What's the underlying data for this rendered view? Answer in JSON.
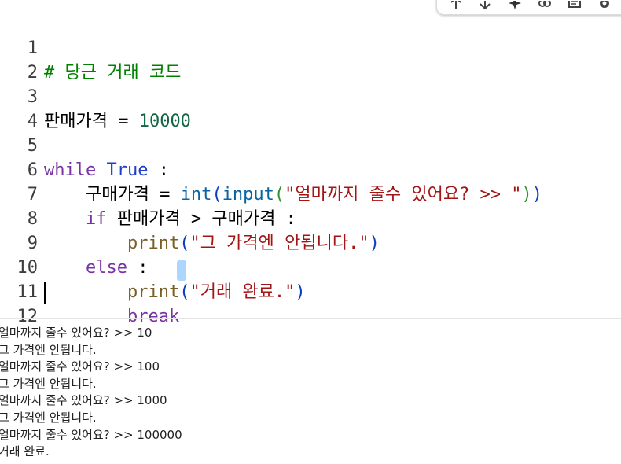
{
  "toolbar": {
    "buttons": [
      "move-up-icon",
      "move-down-icon",
      "sparkle-icon",
      "link-icon",
      "comment-icon",
      "settings-icon"
    ]
  },
  "editor": {
    "lines": [
      {
        "number": "1",
        "text": "# 당근 거래 코드"
      },
      {
        "number": "2",
        "text": ""
      },
      {
        "number": "3",
        "text": "판매가격 = 10000"
      },
      {
        "number": "4",
        "text": ""
      },
      {
        "number": "5",
        "text": "while True :"
      },
      {
        "number": "6",
        "text": "    구매가격 = int(input(\"얼마까지 줄수 있어요? >> \"))"
      },
      {
        "number": "7",
        "text": "    if 판매가격 > 구매가격 :"
      },
      {
        "number": "8",
        "text": "        print(\"그 가격엔 안됩니다.\")"
      },
      {
        "number": "9",
        "text": "    else :"
      },
      {
        "number": "10",
        "text": "        print(\"거래 완료.\")"
      },
      {
        "number": "11",
        "text": "        break"
      },
      {
        "number": "12",
        "text": ""
      }
    ]
  },
  "output": {
    "lines": [
      "얼마까지 줄수 있어요? >> 10",
      "그 가격엔 안됩니다.",
      "얼마까지 줄수 있어요? >> 100",
      "그 가격엔 안됩니다.",
      "얼마까지 줄수 있어요? >> 1000",
      "그 가격엔 안됩니다.",
      "얼마까지 줄수 있어요? >> 100000",
      "거래 완료."
    ]
  }
}
